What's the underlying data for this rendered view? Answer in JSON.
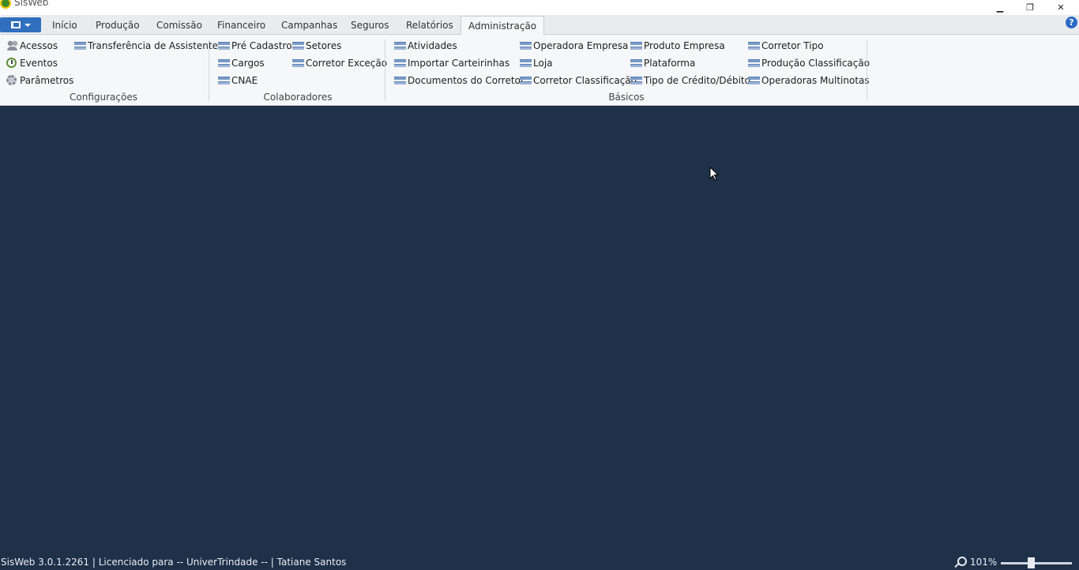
{
  "window": {
    "title": "SisWeb",
    "minimize_glyph": "▁",
    "restore_glyph": "❐",
    "close_glyph": "✕"
  },
  "tabs": [
    "Início",
    "Produção",
    "Comissão",
    "Financeiro",
    "Campanhas",
    "Seguros",
    "Relatórios",
    "Administração"
  ],
  "active_tab": "Administração",
  "help_glyph": "?",
  "ribbon": {
    "configuracoes": {
      "label": "Configurações",
      "items": [
        "Acessos",
        "Eventos",
        "Parâmetros",
        "Transferência de Assistente"
      ]
    },
    "colaboradores": {
      "label": "Colaboradores",
      "items": [
        "Pré Cadastro",
        "Cargos",
        "CNAE",
        "Setores",
        "Corretor Exceção"
      ]
    },
    "basicos": {
      "label": "Básicos",
      "items": [
        "Atividades",
        "Importar Carteirinhas",
        "Documentos do Corretor",
        "Operadora Empresa",
        "Loja",
        "Corretor Classificação",
        "Produto Empresa",
        "Plataforma",
        "Tipo de Crédito/Débito",
        "Corretor Tipo",
        "Produção Classificação",
        "Operadoras Multinotas"
      ]
    }
  },
  "status": {
    "info": "SisWeb 3.0.1.2261 | Licenciado para -- UniverTrindade -- | Tatiane Santos",
    "zoom": "101%"
  },
  "colors": {
    "workspace": "#1f3049",
    "ribbon": "#f6f7f8",
    "accent": "#2f6fbe"
  }
}
